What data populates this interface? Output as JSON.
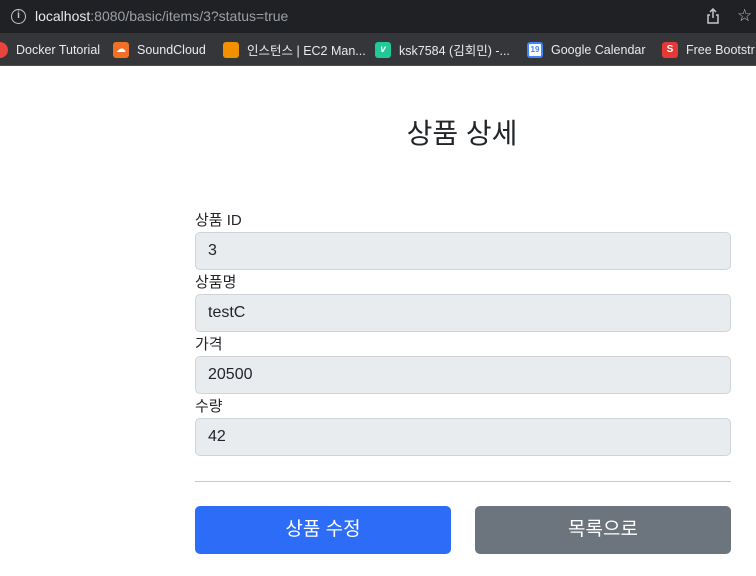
{
  "browser": {
    "url_host": "localhost",
    "url_rest": ":8080/basic/items/3?status=true"
  },
  "bookmarks": [
    {
      "label": "Docker Tutorial",
      "icon": "docker-icon",
      "color": "#e8453c"
    },
    {
      "label": "SoundCloud",
      "icon": "soundcloud-icon",
      "color": "#f26f23"
    },
    {
      "label": "인스턴스 | EC2 Man...",
      "icon": "aws-ec2-icon",
      "color": "#f29100"
    },
    {
      "label": "ksk7584 (김회민) -...",
      "icon": "velog-icon",
      "color": "#20c997"
    },
    {
      "label": "Google Calendar",
      "icon": "google-calendar-icon",
      "color": "#4285f4",
      "glyph": "19"
    },
    {
      "label": "Free Bootstr",
      "icon": "bootstrap-s-icon",
      "color": "#e53935",
      "glyph": "S"
    }
  ],
  "page": {
    "title": "상품 상세"
  },
  "form": {
    "fields": [
      {
        "label": "상품 ID",
        "value": "3"
      },
      {
        "label": "상품명",
        "value": "testC"
      },
      {
        "label": "가격",
        "value": "20500"
      },
      {
        "label": "수량",
        "value": "42"
      }
    ]
  },
  "actions": {
    "edit_label": "상품 수정",
    "list_label": "목록으로"
  },
  "colors": {
    "primary": "#2c6cf6",
    "secondary": "#6c757d",
    "field_bg": "#e9ecef"
  }
}
